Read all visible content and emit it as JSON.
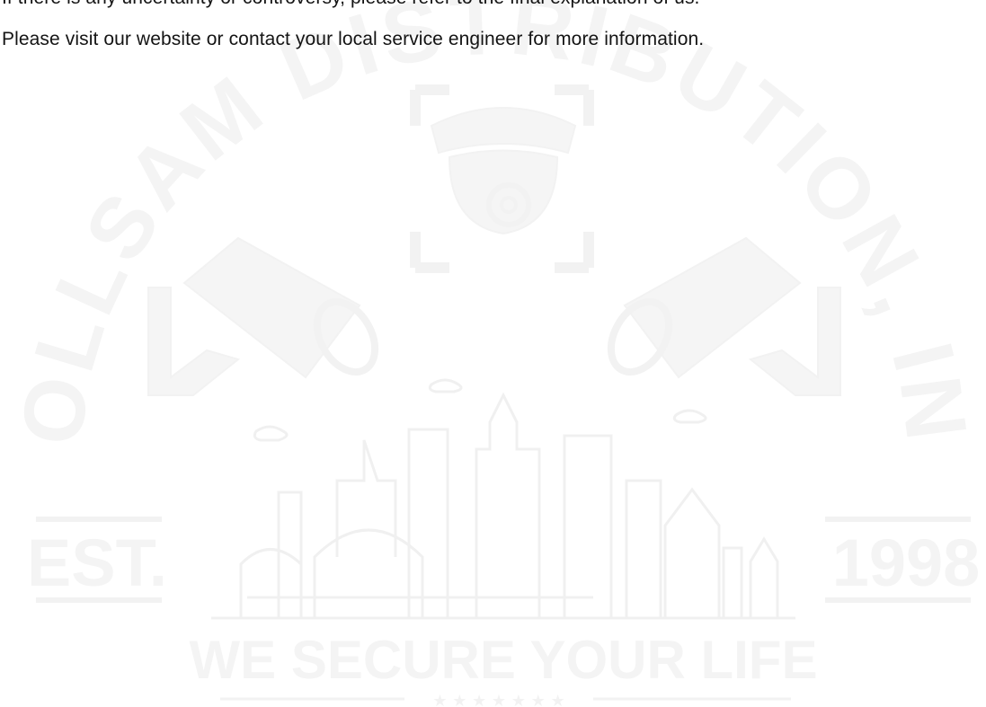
{
  "document": {
    "lines": [
      "If there is any uncertainty or controversy, please refer to the final explanation of us.",
      "Please visit our website or contact your local service engineer for more information."
    ]
  },
  "watermark": {
    "arc_text": "COLLSAM DISTRIBUTION, INC",
    "est_label": "EST.",
    "year": "1998",
    "slogan": "WE SECURE YOUR LIFE",
    "stars": "★ ★ ★ ★ ★ ★ ★",
    "color": "#f4f4f4",
    "icons": [
      "dome-camera-icon",
      "bullet-camera-icon",
      "bullet-camera-icon",
      "city-skyline-icon"
    ]
  }
}
